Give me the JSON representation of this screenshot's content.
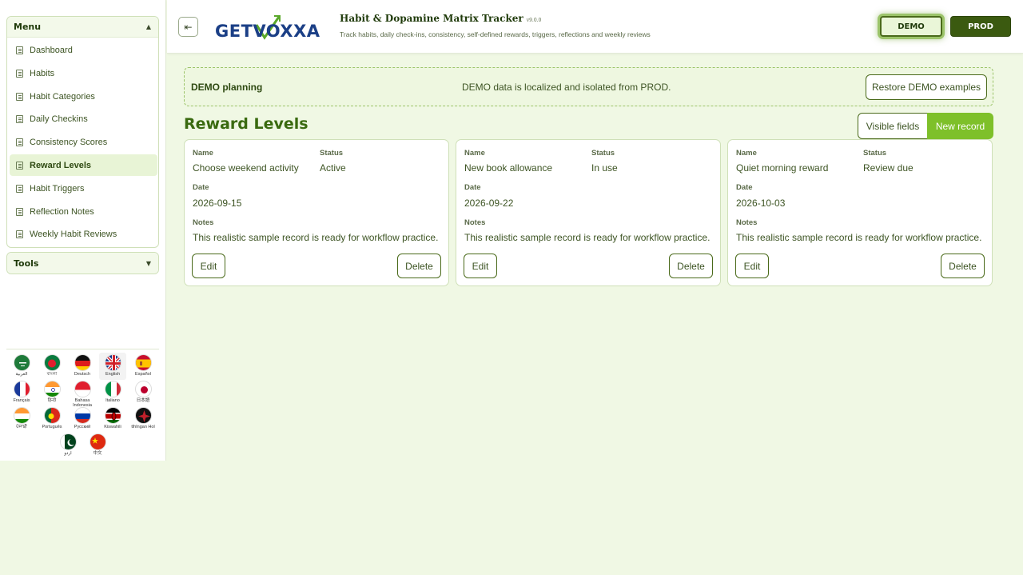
{
  "sidebar": {
    "menu_title": "Menu",
    "menu_items": [
      {
        "label": "Dashboard"
      },
      {
        "label": "Habits"
      },
      {
        "label": "Habit Categories"
      },
      {
        "label": "Daily Checkins"
      },
      {
        "label": "Consistency Scores"
      },
      {
        "label": "Reward Levels",
        "active": true
      },
      {
        "label": "Habit Triggers"
      },
      {
        "label": "Reflection Notes"
      },
      {
        "label": "Weekly Habit Reviews"
      }
    ],
    "tools_title": "Tools",
    "languages": [
      {
        "label": "العربية",
        "icon": "saudi-flag-icon"
      },
      {
        "label": "বাংলা",
        "icon": "bangladesh-flag-icon"
      },
      {
        "label": "Deutsch",
        "icon": "germany-flag-icon"
      },
      {
        "label": "English",
        "icon": "uk-flag-icon",
        "selected": true
      },
      {
        "label": "Español",
        "icon": "spain-flag-icon"
      },
      {
        "label": "Français",
        "icon": "france-flag-icon"
      },
      {
        "label": "हिन्दी",
        "icon": "india-flag-icon"
      },
      {
        "label": "Bahasa Indonesia",
        "icon": "indonesia-flag-icon"
      },
      {
        "label": "Italiano",
        "icon": "italy-flag-icon"
      },
      {
        "label": "日本語",
        "icon": "japan-flag-icon"
      },
      {
        "label": "ਪੰਜਾਬੀ",
        "icon": "punjab-flag-icon"
      },
      {
        "label": "Português",
        "icon": "portugal-flag-icon"
      },
      {
        "label": "Русский",
        "icon": "russia-flag-icon"
      },
      {
        "label": "Kiswahili",
        "icon": "kenya-flag-icon"
      },
      {
        "label": "tlhIngan Hol",
        "icon": "klingon-flag-icon"
      },
      {
        "label": "اردو",
        "icon": "pakistan-flag-icon"
      },
      {
        "label": "中文",
        "icon": "china-flag-icon"
      }
    ]
  },
  "header": {
    "logo_text": "GETVOXXA",
    "title": "Habit & Dopamine Matrix Tracker",
    "version": "v9.0.0",
    "subtitle": "Track habits, daily check-ins, consistency, self-defined rewards, triggers, reflections and weekly reviews",
    "demo_label": "DEMO",
    "prod_label": "PROD"
  },
  "banner": {
    "title": "DEMO planning",
    "message": "DEMO data is localized and isolated from PROD.",
    "restore_label": "Restore DEMO examples"
  },
  "main": {
    "page_title": "Reward Levels",
    "visible_fields_label": "Visible fields",
    "new_record_label": "New record",
    "labels": {
      "name": "Name",
      "status": "Status",
      "date": "Date",
      "notes": "Notes",
      "edit": "Edit",
      "delete": "Delete"
    },
    "records": [
      {
        "name": "Choose weekend activity",
        "status": "Active",
        "date": "2026-09-15",
        "notes": "This realistic sample record is ready for workflow practice."
      },
      {
        "name": "New book allowance",
        "status": "In use",
        "date": "2026-09-22",
        "notes": "This realistic sample record is ready for workflow practice."
      },
      {
        "name": "Quiet morning reward",
        "status": "Review due",
        "date": "2026-10-03",
        "notes": "This realistic sample record is ready for workflow practice."
      }
    ]
  },
  "colors": {
    "accent": "#7ec02a",
    "dark_green": "#3b5a10",
    "background": "#f0f8e4"
  }
}
